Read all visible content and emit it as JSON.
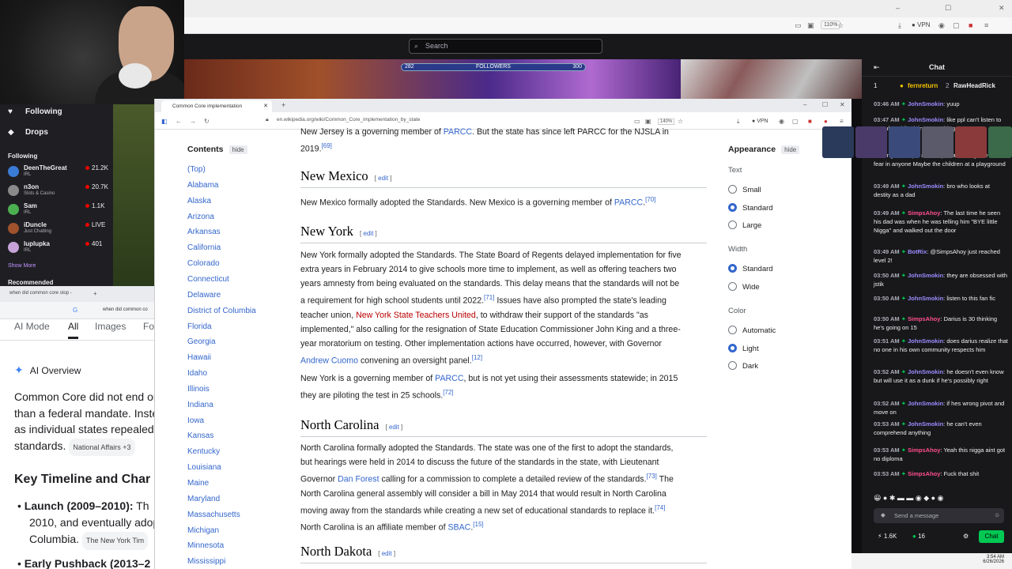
{
  "top_browser": {
    "zoom": "110%",
    "vpn": "VPN"
  },
  "twitch": {
    "search_placeholder": "Search",
    "followers_bar": {
      "label": "FOLLOWERS",
      "current": "282",
      "goal": "300",
      "progress": 0.94
    },
    "header_count": "16",
    "nav": {
      "following": "Following",
      "drops": "Drops"
    },
    "following_header": "Following",
    "channels": [
      {
        "name": "DeenTheGreat",
        "game": "IRL",
        "viewers": "21.2K",
        "color": "#3a7bd5"
      },
      {
        "name": "n3on",
        "game": "Slots & Casino",
        "viewers": "20.7K",
        "color": "#8a8a8a"
      },
      {
        "name": "Sam",
        "game": "IRL",
        "viewers": "1.1K",
        "color": "#4caf50"
      },
      {
        "name": "iDuncle",
        "game": "Just Chatting",
        "viewers": "LIVE",
        "color": "#a0522d"
      },
      {
        "name": "luplupka",
        "game": "IRL",
        "viewers": "401",
        "color": "#c7a2d8"
      }
    ],
    "show_more": "Show More",
    "recommended": "Recommended"
  },
  "google": {
    "tab_title": "when did common core stop -",
    "query": "when did common co",
    "tabs": [
      "AI Mode",
      "All",
      "Images",
      "Fo"
    ],
    "ai_overview": "AI Overview",
    "paragraph_lines": [
      "Common Core did not end or",
      "than a federal mandate. Inste",
      "as individual states repealed",
      "standards."
    ],
    "source_chip": "National Affairs +3",
    "section_title": "Key Timeline and Char",
    "bullets": [
      {
        "bold": "Launch (2009–2010):",
        "text": " Th",
        "line2": "2010, and eventually adop",
        "line3": "Columbia.",
        "chip": "The New York Tim"
      },
      {
        "bold": "Early Pushback (2013–2",
        "text": "",
        "line2": "",
        "line3": "",
        "chip": ""
      }
    ]
  },
  "wiki": {
    "tab_title": "Common Core implementation",
    "url": "en.wikipedia.org/wiki/Common_Core_implementation_by_state",
    "zoom": "140%",
    "vpn": "VPN",
    "contents": "Contents",
    "hide": "hide",
    "toc": [
      "(Top)",
      "Alabama",
      "Alaska",
      "Arizona",
      "Arkansas",
      "California",
      "Colorado",
      "Connecticut",
      "Delaware",
      "District of Columbia",
      "Florida",
      "Georgia",
      "Hawaii",
      "Idaho",
      "Illinois",
      "Indiana",
      "Iowa",
      "Kansas",
      "Kentucky",
      "Louisiana",
      "Maine",
      "Maryland",
      "Massachusetts",
      "Michigan",
      "Minnesota",
      "Mississippi"
    ],
    "edit": "edit",
    "nj_tail": {
      "pre": "New Jersey is a governing member of ",
      "link": "PARCC",
      "post": ". But the state has since left PARCC for the NJSLA in",
      "line2": "2019.",
      "ref": "[69]"
    },
    "new_mexico": {
      "title": "New Mexico",
      "pre": "New Mexico formally adopted the Standards. New Mexico is a governing member of ",
      "link": "PARCC",
      "post": ".",
      "ref": "[70]"
    },
    "new_york": {
      "title": "New York",
      "p1": {
        "l1": "New York formally adopted the Standards. The State Board of Regents delayed implementation for five",
        "l2": "extra years in February 2014 to give schools more time to implement, as well as offering teachers two",
        "l3": "years amnesty from being evaluated on the standards. This delay means that the standards will not be",
        "l4a": "a requirement for high school students until 2022.",
        "ref71": "[71]",
        "l4b": " Issues have also prompted the state's leading",
        "l5a": "teacher union, ",
        "l5link": "New York State Teachers United",
        "l5b": ", to withdraw their support of the standards \"as",
        "l6": "implemented,\" also calling for the resignation of State Education Commissioner John King and a three-",
        "l7": "year moratorium on testing. Other implementation actions have occurred, however, with Governor",
        "l8link": "Andrew Cuomo",
        "l8b": " convening an oversight panel.",
        "ref12": "[12]"
      },
      "p2": {
        "pre": "New York is a governing member of ",
        "link": "PARCC",
        "post": ", but is not yet using their assessments statewide; in 2015",
        "l2": "they are piloting the test in 25 schools.",
        "ref": "[72]"
      }
    },
    "north_carolina": {
      "title": "North Carolina",
      "l1": "North Carolina formally adopted the Standards. The state was one of the first to adopt the standards,",
      "l2": "but hearings were held in 2014 to discuss the future of the standards in the state, with Lieutenant",
      "l3a": "Governor ",
      "l3link": "Dan Forest",
      "l3b": " calling for a commission to complete a detailed review of the standards.",
      "ref73": "[73]",
      "l3c": " The",
      "l4": "North Carolina general assembly will consider a bill in May 2014 that would result in North Carolina",
      "l5": "moving away from the standards while creating a new set of educational standards to replace it.",
      "ref74": "[74]",
      "l6a": "North Carolina is an affiliate member of ",
      "l6link": "SBAC",
      "l6b": ".",
      "ref15": "[15]"
    },
    "north_dakota": {
      "title": "North Dakota"
    },
    "appearance": {
      "title": "Appearance",
      "text_label": "Text",
      "text_opts": [
        "Small",
        "Standard",
        "Large"
      ],
      "text_selected": 1,
      "width_label": "Width",
      "width_opts": [
        "Standard",
        "Wide"
      ],
      "width_selected": 0,
      "color_label": "Color",
      "color_opts": [
        "Automatic",
        "Light",
        "Dark"
      ],
      "color_selected": 1
    }
  },
  "chat": {
    "title": "Chat",
    "pinned": {
      "rank": "1",
      "user1": "fernreturn",
      "n1": "2",
      "user2": "RawHeadRick"
    },
    "messages": [
      {
        "time": "03:46 AM",
        "user": "JohnSmokin",
        "ucolor": "#9b8cff",
        "text": ": yuup"
      },
      {
        "time": "03:47 AM",
        "user": "JohnSmokin",
        "ucolor": "#9b8cff",
        "text": ": like ppl can't listen to youtube while doing something"
      },
      {
        "time": "",
        "user": "",
        "ucolor": "#efeff1",
        "text": "walking Hot Topic mannequin and things he strikes fear in anyone   Maybe the children at a playground"
      },
      {
        "time": "03:49 AM",
        "user": "JohnSmokin",
        "ucolor": "#9b8cff",
        "text": ": bro who looks at destity as a dad"
      },
      {
        "time": "03:49 AM",
        "user": "SimpsAhoy",
        "ucolor": "#ff4f8b",
        "text": ": The last time he seen his dad was when he was telling him \"BYE little Nigga\" and walked out the door"
      },
      {
        "time": "03:49 AM",
        "user": "BotRix",
        "ucolor": "#9b8cff",
        "text": ": @SimpsAhoy just reached level 2!"
      },
      {
        "time": "03:50 AM",
        "user": "JohnSmokin",
        "ucolor": "#9b8cff",
        "text": ": they are obsessed with jstik"
      },
      {
        "time": "03:50 AM",
        "user": "JohnSmokin",
        "ucolor": "#9b8cff",
        "text": ": listen to this fan fic"
      },
      {
        "time": "03:50 AM",
        "user": "SimpsAhoy",
        "ucolor": "#ff4f8b",
        "text": ": Darius is 30 thinking he's going on 15"
      },
      {
        "time": "03:51 AM",
        "user": "JohnSmokin",
        "ucolor": "#9b8cff",
        "text": ": does darius realize that no one in his own community respects him"
      },
      {
        "time": "03:52 AM",
        "user": "JohnSmokin",
        "ucolor": "#9b8cff",
        "text": ": he doesn't even know but will use it as a dunk if he's possibly right"
      },
      {
        "time": "03:52 AM",
        "user": "JohnSmokin",
        "ucolor": "#9b8cff",
        "text": ": if hes wrong pivot and move on"
      },
      {
        "time": "03:53 AM",
        "user": "JohnSmokin",
        "ucolor": "#9b8cff",
        "text": ": he can't even comprehend anything"
      },
      {
        "time": "03:53 AM",
        "user": "SimpsAhoy",
        "ucolor": "#ff4f8b",
        "text": ": Yeah this nigga aint got no diploma"
      },
      {
        "time": "03:53 AM",
        "user": "SimpsAhoy",
        "ucolor": "#ff4f8b",
        "text": ": Fuck that shit"
      }
    ],
    "input_placeholder": "Send a message",
    "bottom": {
      "viewers": "1.6K",
      "points": "16",
      "chat_button": "Chat"
    }
  },
  "taskbar": {
    "time": "3:54 AM",
    "date": "6/26/2026"
  }
}
